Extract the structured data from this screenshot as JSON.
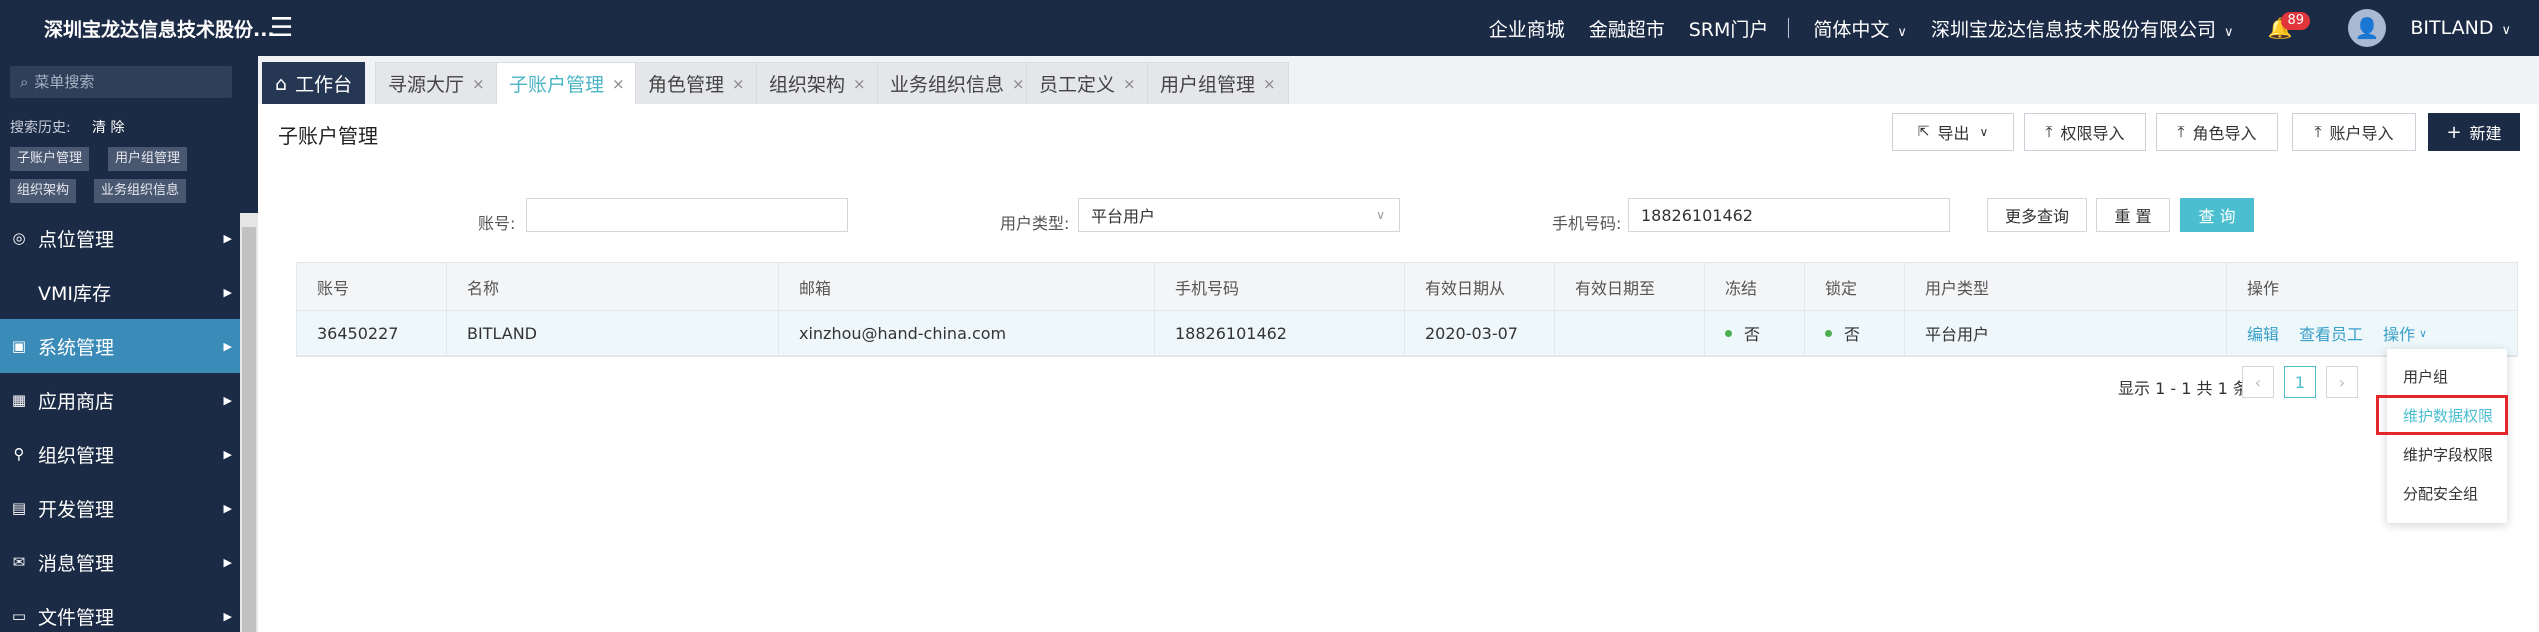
{
  "app": {
    "title": "深圳宝龙达信息技术股份...",
    "menu_toggle_icon": "menu-fold-icon"
  },
  "topbar": {
    "links": [
      "企业商城",
      "金融超市",
      "SRM门户"
    ],
    "language": "简体中文",
    "company": "深圳宝龙达信息技术股份有限公司",
    "notification_count": "89",
    "user": "BITLAND"
  },
  "sidebar": {
    "search_placeholder": "菜单搜索",
    "history_label": "搜索历史:",
    "history_clear": "清 除",
    "history_chips": [
      "子账户管理",
      "用户组管理",
      "组织架构",
      "业务组织信息"
    ],
    "items": [
      {
        "label": "点位管理",
        "icon": "location-icon",
        "active": false
      },
      {
        "label": "VMI库存",
        "icon": "",
        "active": false
      },
      {
        "label": "系统管理",
        "icon": "system-icon",
        "active": true
      },
      {
        "label": "应用商店",
        "icon": "store-icon",
        "active": false
      },
      {
        "label": "组织管理",
        "icon": "org-icon",
        "active": false
      },
      {
        "label": "开发管理",
        "icon": "dev-icon",
        "active": false
      },
      {
        "label": "消息管理",
        "icon": "message-icon",
        "active": false
      },
      {
        "label": "文件管理",
        "icon": "file-icon",
        "active": false
      }
    ]
  },
  "tabs": [
    {
      "label": "工作台",
      "closable": false,
      "kind": "home"
    },
    {
      "label": "寻源大厅",
      "closable": true
    },
    {
      "label": "子账户管理",
      "closable": true,
      "current": true
    },
    {
      "label": "角色管理",
      "closable": true
    },
    {
      "label": "组织架构",
      "closable": true
    },
    {
      "label": "业务组织信息",
      "closable": true
    },
    {
      "label": "员工定义",
      "closable": true
    },
    {
      "label": "用户组管理",
      "closable": true
    }
  ],
  "page": {
    "title": "子账户管理",
    "buttons": {
      "export": "导出",
      "perm_import": "权限导入",
      "role_import": "角色导入",
      "account_import": "账户导入",
      "create": "新建"
    }
  },
  "filters": {
    "account_label": "账号:",
    "account_value": "",
    "user_type_label": "用户类型:",
    "user_type_value": "平台用户",
    "phone_label": "手机号码:",
    "phone_value": "18826101462",
    "more_query": "更多查询",
    "reset": "重 置",
    "query": "查 询"
  },
  "table": {
    "columns": [
      "账号",
      "名称",
      "邮箱",
      "手机号码",
      "有效日期从",
      "有效日期至",
      "冻结",
      "锁定",
      "用户类型",
      "操作"
    ],
    "rows": [
      {
        "account": "36450227",
        "name": "BITLAND",
        "email": "xinzhou@hand-china.com",
        "phone": "18826101462",
        "valid_from": "2020-03-07",
        "valid_to": "",
        "frozen": "否",
        "locked": "否",
        "user_type": "平台用户",
        "actions": {
          "edit": "编辑",
          "view_staff": "查看员工",
          "more": "操作"
        }
      }
    ]
  },
  "pagination": {
    "summary": "显示 1 - 1 共 1 条",
    "current_page": "1",
    "prev_icon": "‹",
    "next_icon": "›"
  },
  "action_menu": {
    "items": [
      "用户组",
      "维护数据权限",
      "维护字段权限",
      "分配安全组"
    ],
    "highlighted_index": 1
  },
  "colors": {
    "nav_bg": "#1c2b45",
    "active_nav": "#3a8bb8",
    "accent": "#4bbfd0",
    "highlight_box": "#e5262b"
  }
}
